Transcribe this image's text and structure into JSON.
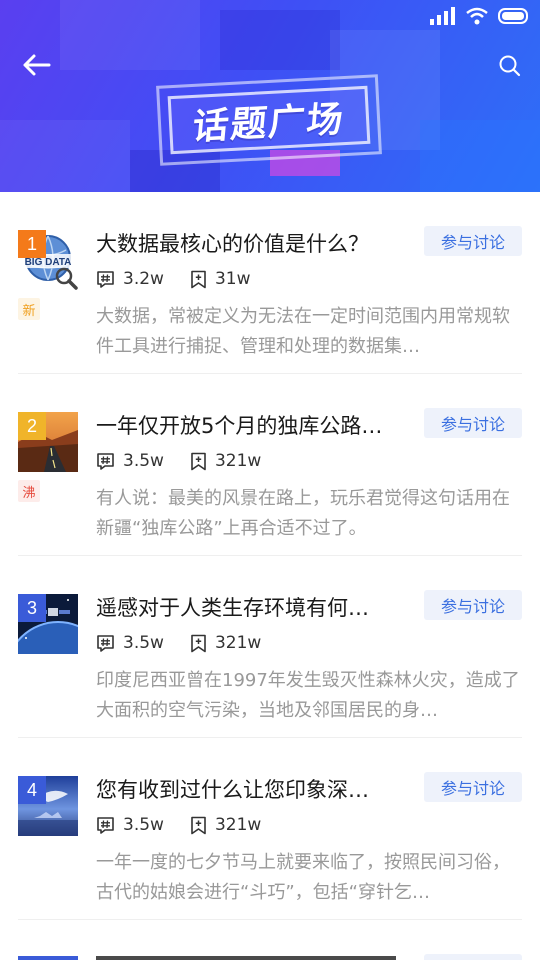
{
  "header": {
    "title": "话题广场",
    "back_icon": "arrow-left-icon",
    "search_icon": "search-icon"
  },
  "status_bar": {
    "signal": "signal-icon",
    "wifi": "wifi-icon",
    "battery": "battery-icon"
  },
  "topics": [
    {
      "rank": "1",
      "rank_color": "#f47a1a",
      "tag": "新",
      "tag_color": "#f0a020",
      "tag_bg": "#fdf4e3",
      "title": "大数据最核心的价值是什么？",
      "join_label": "参与讨论",
      "posts": "3.2w",
      "follows": "31w",
      "description": "大数据，常被定义为无法在一定时间范围内用常规软件工具进行捕捉、管理和处理的数据集…",
      "thumb_text": "BIG DATA"
    },
    {
      "rank": "2",
      "rank_color": "#f0b42a",
      "tag": "沸",
      "tag_color": "#e64a3c",
      "tag_bg": "#fdecea",
      "title": "一年仅开放5个月的独库公路…",
      "join_label": "参与讨论",
      "posts": "3.5w",
      "follows": "321w",
      "description": "有人说：最美的风景在路上，玩乐君觉得这句话用在新疆“独库公路”上再合适不过了。"
    },
    {
      "rank": "3",
      "rank_color": "#3a5bd8",
      "tag": "",
      "title": "遥感对于人类生存环境有何…",
      "join_label": "参与讨论",
      "posts": "3.5w",
      "follows": "321w",
      "description": "印度尼西亚曾在1997年发生毁灭性森林火灾，造成了大面积的空气污染，当地及邻国居民的身…"
    },
    {
      "rank": "4",
      "rank_color": "#3a5bd8",
      "tag": "",
      "title": "您有收到过什么让您印象深…",
      "join_label": "参与讨论",
      "posts": "3.5w",
      "follows": "321w",
      "description": "一年一度的七夕节马上就要来临了，按照民间习俗，古代的姑娘会进行“斗巧”，包括“穿针乞…"
    }
  ],
  "icons": {
    "posts": "hashtag-icon",
    "follows": "bookmark-icon"
  }
}
